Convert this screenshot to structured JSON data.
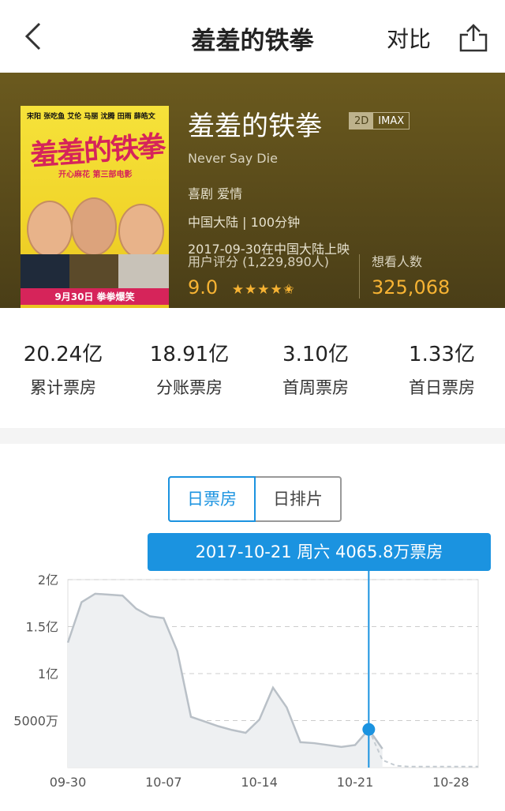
{
  "nav": {
    "title": "羞羞的铁拳",
    "compare_label": "对比"
  },
  "movie": {
    "poster": {
      "title": "羞羞的铁拳",
      "cast_line": "宋阳 张吃鱼 艾伦 马丽 沈腾 田雨 薛皓文",
      "subtitle": "开心麻花 第三部电影",
      "date": "9月30日 拳拳爆笑"
    },
    "title": "羞羞的铁拳",
    "badge_2d": "2D",
    "badge_imax": "IMAX",
    "english_title": "Never Say Die",
    "genres": "喜剧  爱情",
    "country_duration": "中国大陆  |  100分钟",
    "release": "2017-09-30在中国大陆上映",
    "rating_label": "用户评分 (1,229,890人)",
    "rating": "9.0",
    "stars": "★★★★✬",
    "want_label": "想看人数",
    "want_count": "325,068"
  },
  "stats": [
    {
      "value": "20.24亿",
      "label": "累计票房"
    },
    {
      "value": "18.91亿",
      "label": "分账票房"
    },
    {
      "value": "3.10亿",
      "label": "首周票房"
    },
    {
      "value": "1.33亿",
      "label": "首日票房"
    }
  ],
  "tabs": [
    {
      "label": "日票房"
    },
    {
      "label": "日排片"
    }
  ],
  "tooltip": "2017-10-21 周六 4065.8万票房",
  "colors": {
    "accent": "#1b93e0",
    "rating": "#f7b333"
  },
  "chart_data": {
    "type": "area",
    "x_ticks": [
      "09-30",
      "10-07",
      "10-14",
      "10-21",
      "10-28"
    ],
    "y_ticks": [
      "2亿",
      "1.5亿",
      "1亿",
      "5000万"
    ],
    "y_values_ticks": [
      20000,
      15000,
      10000,
      5000
    ],
    "ylim": [
      0,
      20000
    ],
    "y_unit": "万",
    "days": [
      "09-30",
      "10-01",
      "10-02",
      "10-03",
      "10-04",
      "10-05",
      "10-06",
      "10-07",
      "10-08",
      "10-09",
      "10-10",
      "10-11",
      "10-12",
      "10-13",
      "10-14",
      "10-15",
      "10-16",
      "10-17",
      "10-18",
      "10-19",
      "10-20",
      "10-21",
      "10-22",
      "10-23"
    ],
    "values": [
      13300,
      17600,
      18500,
      18400,
      18300,
      16900,
      16100,
      15900,
      12400,
      5400,
      4900,
      4400,
      4000,
      3700,
      5100,
      8500,
      6400,
      2700,
      2600,
      2400,
      2200,
      2400,
      4065.8,
      2000
    ],
    "forecast": [
      [
        22,
        4065.8
      ],
      [
        23,
        800
      ],
      [
        24,
        200
      ],
      [
        25,
        100
      ],
      [
        26,
        100
      ],
      [
        27,
        100
      ],
      [
        28,
        100
      ],
      [
        29,
        100
      ],
      [
        30,
        100
      ]
    ],
    "highlight_index": 22,
    "grid": true
  }
}
